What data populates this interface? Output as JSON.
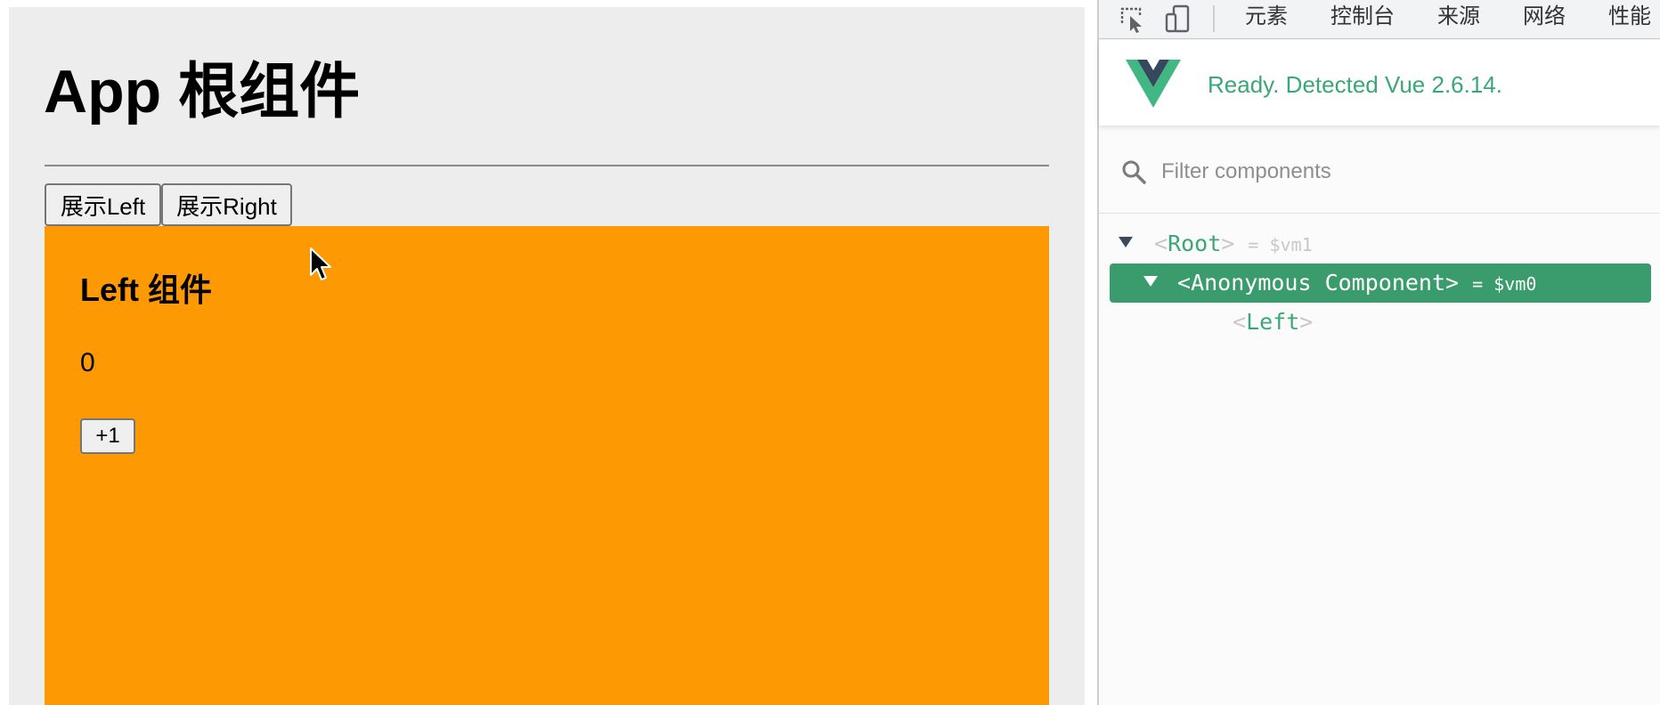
{
  "app": {
    "title": "App 根组件",
    "buttons": {
      "show_left": "展示Left",
      "show_right": "展示Right"
    },
    "left_component": {
      "heading": "Left 组件",
      "count": "0",
      "increment_label": "+1",
      "background": "#fd9902"
    }
  },
  "devtools": {
    "tabs": [
      "元素",
      "控制台",
      "来源",
      "网络",
      "性能"
    ],
    "status": "Ready. Detected Vue 2.6.14.",
    "filter": {
      "placeholder": "Filter components",
      "value": ""
    },
    "tree": {
      "root": {
        "name": "Root",
        "vm": "= $vm1"
      },
      "anonymous": {
        "name": "Anonymous Component",
        "vm": "= $vm0",
        "selected": true
      },
      "left": {
        "name": "Left"
      }
    },
    "colors": {
      "accent": "#3ba776",
      "selected_row": "#3a9b6c"
    },
    "icons": [
      "inspect-element-icon",
      "device-toggle-icon",
      "vue-logo-icon",
      "search-icon"
    ]
  }
}
